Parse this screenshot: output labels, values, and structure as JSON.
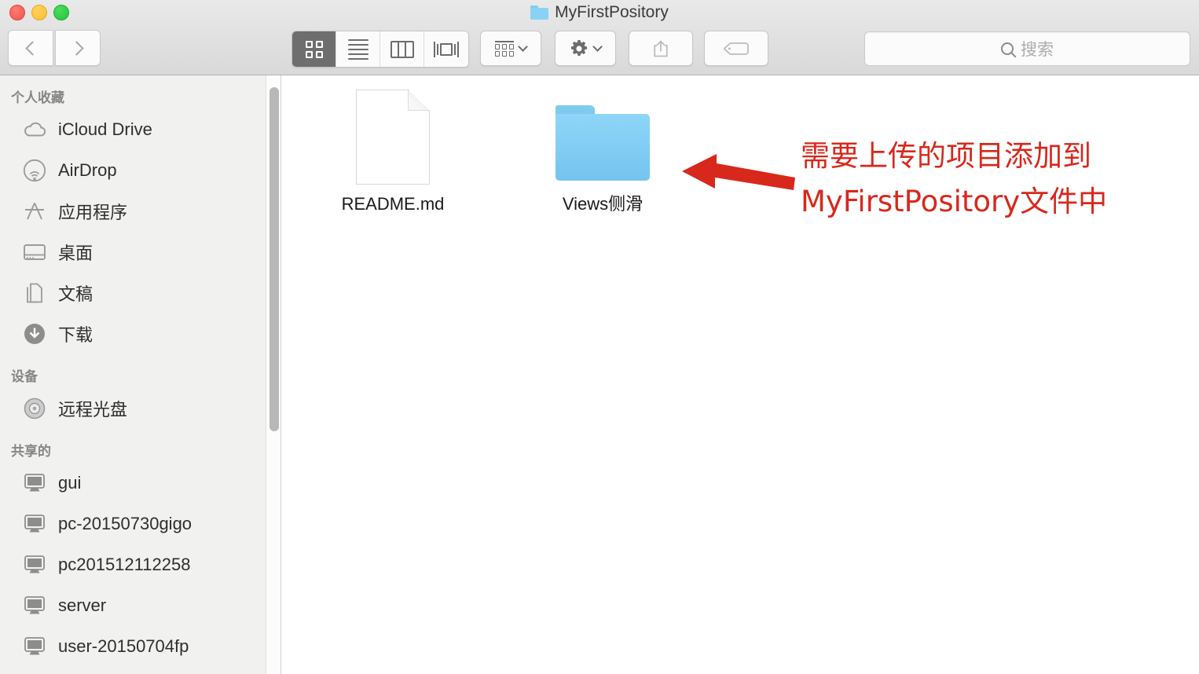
{
  "window": {
    "title": "MyFirstPository",
    "traffic_lights": [
      {
        "name": "close",
        "color": "#f0554c"
      },
      {
        "name": "minimize",
        "color": "#fbbd30"
      },
      {
        "name": "zoom",
        "color": "#25c33c"
      }
    ]
  },
  "toolbar": {
    "back_label": "",
    "forward_label": "",
    "view_modes": [
      {
        "name": "icon-view",
        "selected": true
      },
      {
        "name": "list-view",
        "selected": false
      },
      {
        "name": "column-view",
        "selected": false
      },
      {
        "name": "coverflow-view",
        "selected": false
      }
    ],
    "arrange_label": "",
    "action_label": "",
    "share_label": "",
    "tags_label": ""
  },
  "search": {
    "placeholder": "搜索",
    "value": ""
  },
  "sidebar": {
    "sections": [
      {
        "header": "个人收藏",
        "items": [
          {
            "label": "iCloud Drive",
            "icon": "cloud-icon"
          },
          {
            "label": "AirDrop",
            "icon": "airdrop-icon"
          },
          {
            "label": "应用程序",
            "icon": "applications-icon"
          },
          {
            "label": "桌面",
            "icon": "desktop-icon"
          },
          {
            "label": "文稿",
            "icon": "documents-icon"
          },
          {
            "label": "下载",
            "icon": "downloads-icon"
          }
        ]
      },
      {
        "header": "设备",
        "items": [
          {
            "label": "远程光盘",
            "icon": "disc-icon"
          }
        ]
      },
      {
        "header": "共享的",
        "items": [
          {
            "label": "gui",
            "icon": "computer-icon"
          },
          {
            "label": "pc-20150730gigo",
            "icon": "computer-icon"
          },
          {
            "label": "pc201512112258",
            "icon": "computer-icon"
          },
          {
            "label": "server",
            "icon": "computer-icon"
          },
          {
            "label": "user-20150704fp",
            "icon": "computer-icon"
          }
        ]
      }
    ]
  },
  "content": {
    "files": [
      {
        "name": "README.md",
        "type": "document"
      },
      {
        "name": "Views侧滑",
        "type": "folder"
      }
    ]
  },
  "annotation": {
    "text": "需要上传的项目添加到MyFirstPository文件中",
    "color": "#d8281c",
    "arrow_direction": "left"
  }
}
